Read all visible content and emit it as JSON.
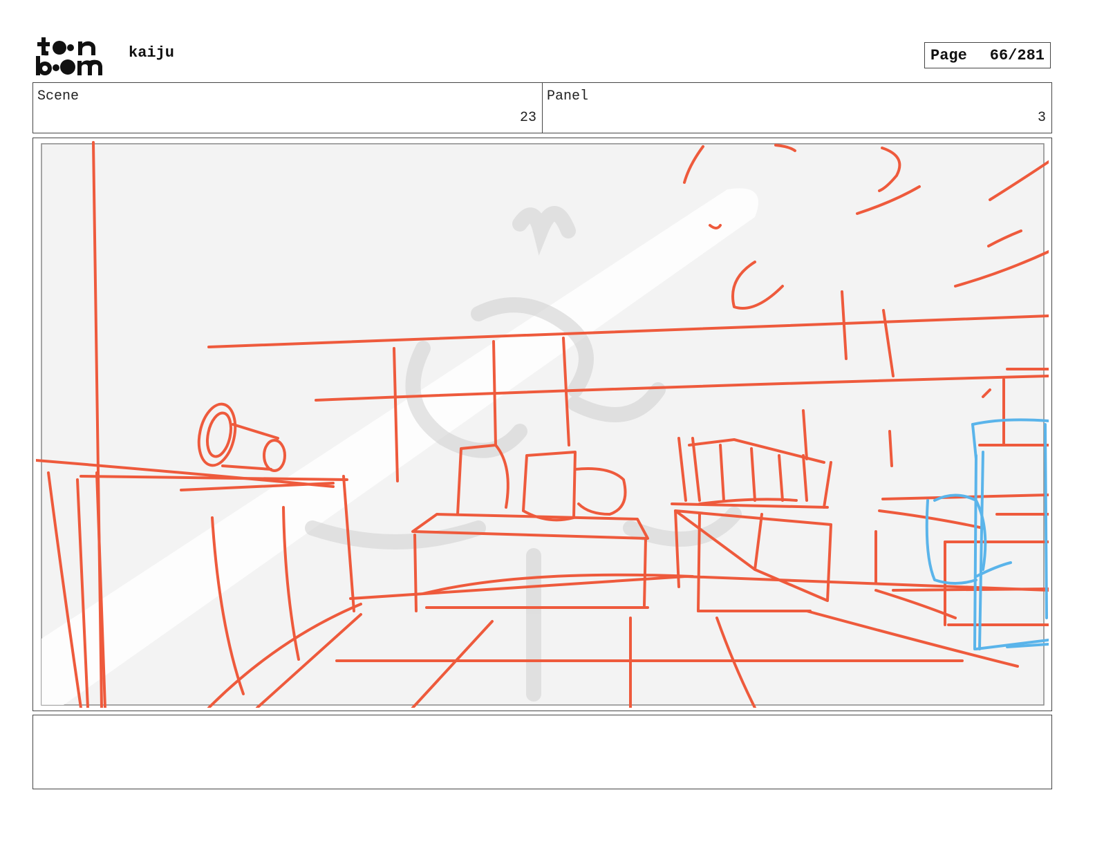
{
  "header": {
    "logo_text": "toon boom",
    "project_title": "kaiju",
    "page_label": "Page",
    "page_number": "66/281"
  },
  "info": {
    "scene_label": "Scene",
    "scene_value": "23",
    "panel_label": "Panel",
    "panel_value": "3"
  },
  "panel": {
    "sketch_color": "#ee5a3c",
    "highlight_color": "#5ab4ea",
    "background_color": "#f3f3f3"
  },
  "notes": {
    "text": ""
  }
}
